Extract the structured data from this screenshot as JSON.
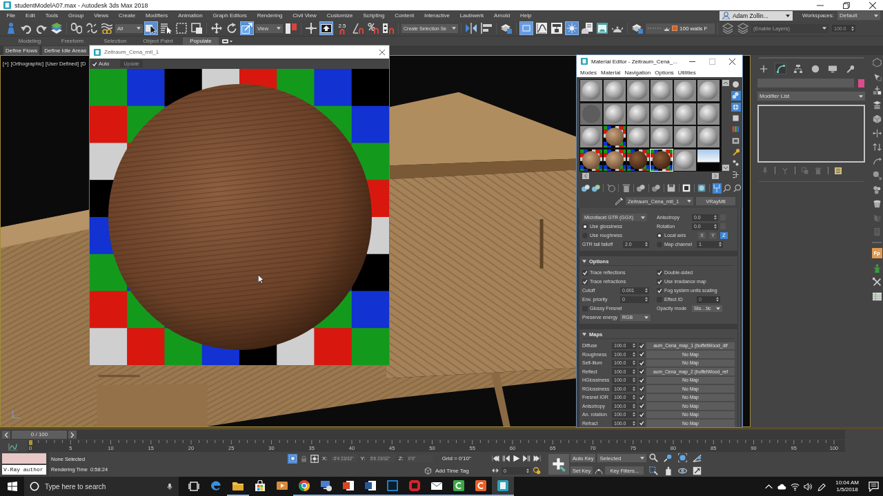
{
  "window": {
    "title": "studentModelA07.max - Autodesk 3ds Max 2018"
  },
  "menu": {
    "items": [
      "File",
      "Edit",
      "Tools",
      "Group",
      "Views",
      "Create",
      "Modifiers",
      "Animation",
      "Graph Editors",
      "Rendering",
      "Civil View",
      "Customize",
      "Scripting",
      "Content",
      "Interactive",
      "Laubwerk",
      "Arnold",
      "Help"
    ],
    "user": "Adam Zollin...",
    "workspaces_label": "Workspaces:",
    "workspace": "Default"
  },
  "main_toolbar": [
    {
      "kind": "button",
      "selected": false
    },
    {
      "kind": "button",
      "selected": false
    },
    {
      "kind": "button",
      "selected": false
    },
    {
      "kind": "button",
      "selected": false
    },
    {
      "kind": "separator"
    },
    {
      "kind": "button",
      "selected": false
    },
    {
      "kind": "button",
      "selected": false
    },
    {
      "kind": "button",
      "selected": false
    },
    {
      "kind": "dropdown",
      "value": "All",
      "disabled": false
    },
    {
      "kind": "button",
      "selected": true
    },
    {
      "kind": "button",
      "selected": false
    },
    {
      "kind": "button",
      "selected": false
    },
    {
      "kind": "button",
      "selected": false
    },
    {
      "kind": "separator"
    },
    {
      "kind": "button",
      "selected": false
    },
    {
      "kind": "button",
      "selected": false
    },
    {
      "kind": "button",
      "selected": true
    },
    {
      "kind": "dropdown",
      "value": "View",
      "disabled": false
    },
    {
      "kind": "button",
      "selected": false
    },
    {
      "kind": "separator"
    },
    {
      "kind": "button",
      "selected": false
    },
    {
      "kind": "button",
      "selected": true
    },
    {
      "kind": "snap",
      "label": "2.5",
      "selected": false
    },
    {
      "kind": "button",
      "selected": false
    },
    {
      "kind": "button",
      "selected": false
    },
    {
      "kind": "button",
      "selected": false
    },
    {
      "kind": "separator"
    },
    {
      "kind": "dropdown",
      "value": "Create Selection Se",
      "disabled": false
    },
    {
      "kind": "separator"
    },
    {
      "kind": "button",
      "selected": false
    },
    {
      "kind": "button",
      "selected": false
    },
    {
      "kind": "separator"
    },
    {
      "kind": "button",
      "selected": false
    },
    {
      "kind": "separator"
    },
    {
      "kind": "button",
      "selected": true
    },
    {
      "kind": "button",
      "selected": false
    },
    {
      "kind": "button",
      "selected": false
    },
    {
      "kind": "button",
      "selected": true
    },
    {
      "kind": "button",
      "selected": false
    },
    {
      "kind": "button",
      "selected": false
    },
    {
      "kind": "button",
      "selected": false
    },
    {
      "kind": "separator"
    },
    {
      "kind": "button",
      "selected": false
    },
    {
      "kind": "layer",
      "value": "100 walls F"
    },
    {
      "kind": "separator"
    },
    {
      "kind": "button",
      "selected": false
    },
    {
      "kind": "button",
      "selected": false
    },
    {
      "kind": "dropdown",
      "value": "(Enable Layers)",
      "disabled": true
    },
    {
      "kind": "spinner",
      "value": "100.0",
      "disabled": true
    }
  ],
  "ribbon": {
    "tabs": [
      {
        "label": "Modeling",
        "selected": false
      },
      {
        "label": "Freeform",
        "selected": false
      },
      {
        "label": "Selection",
        "selected": false
      },
      {
        "label": "Object Paint",
        "selected": false
      },
      {
        "label": "Populate",
        "selected": true
      }
    ],
    "buttons": [
      "Define Flows",
      "Define Idle Areas"
    ]
  },
  "viewport": {
    "labels": [
      "[+]",
      "[Orthographic]",
      "[User Defined]",
      "[D"
    ]
  },
  "render_window": {
    "title": "Zeitraum_Cena_mtl_1",
    "auto": {
      "label": "Auto",
      "checked": true
    },
    "update": {
      "label": "Update",
      "disabled": true
    }
  },
  "material_editor": {
    "title": "Material Editor - Zeitraum_Cena_...",
    "menu": [
      "Modes",
      "Material",
      "Navigation",
      "Options",
      "Utilities"
    ],
    "slots": [
      {
        "kind": "gray",
        "selected": false
      },
      {
        "kind": "gray",
        "selected": false
      },
      {
        "kind": "gray",
        "selected": false
      },
      {
        "kind": "gray",
        "selected": false
      },
      {
        "kind": "gray",
        "selected": false
      },
      {
        "kind": "gray",
        "selected": false
      },
      {
        "kind": "flat",
        "selected": false
      },
      {
        "kind": "gray",
        "selected": false
      },
      {
        "kind": "gray",
        "selected": false
      },
      {
        "kind": "gray",
        "selected": false
      },
      {
        "kind": "gray",
        "selected": false
      },
      {
        "kind": "gray",
        "selected": false
      },
      {
        "kind": "gray",
        "selected": false
      },
      {
        "kind": "wood",
        "selected": false
      },
      {
        "kind": "gray",
        "selected": false
      },
      {
        "kind": "gray",
        "selected": false
      },
      {
        "kind": "gray",
        "selected": false
      },
      {
        "kind": "gray",
        "selected": false
      },
      {
        "kind": "wood",
        "selected": false
      },
      {
        "kind": "wood",
        "selected": false
      },
      {
        "kind": "dark-wood",
        "selected": false
      },
      {
        "kind": "dark-wood",
        "selected": true
      },
      {
        "kind": "gray",
        "selected": false
      },
      {
        "kind": "sky",
        "selected": false
      }
    ],
    "side_buttons": [
      {
        "selected": false
      },
      {
        "selected": true
      },
      {
        "selected": true
      },
      {
        "selected": false
      },
      {
        "selected": false
      },
      {
        "selected": false
      },
      {
        "selected": false
      },
      {
        "selected": false
      },
      {
        "selected": false
      }
    ],
    "toolbar": [
      {
        "selected": false
      },
      {
        "selected": false
      },
      {
        "selected": false
      },
      {
        "selected": false
      },
      {
        "selected": false
      },
      {
        "selected": false
      },
      {
        "selected": false
      },
      {
        "selected": false
      },
      {
        "selected": false
      },
      {
        "selected": true
      },
      {
        "selected": false
      },
      {
        "selected": false
      }
    ],
    "material_name": "Zeitraum_Cena_mtl_1",
    "material_type": "VRayMtl",
    "brdf": {
      "model": "Microfacet GTR (GGX)",
      "modes": [
        {
          "label": "Use glossiness",
          "selected": true
        },
        {
          "label": "Use roughness",
          "selected": false
        }
      ],
      "tail_falloff": {
        "label": "GTR tail falloff",
        "value": "2.0"
      },
      "anisotropy": {
        "label": "Anisotropy",
        "value": "0.0"
      },
      "rotation": {
        "label": "Rotation",
        "value": "0.0"
      },
      "axis_sources": [
        {
          "label": "Local axis",
          "selected": true
        },
        {
          "label": "Map channel",
          "selected": false,
          "value": "1"
        }
      ],
      "axes": [
        {
          "label": "X",
          "selected": false
        },
        {
          "label": "Y",
          "selected": false
        },
        {
          "label": "Z",
          "selected": true
        }
      ]
    },
    "options": {
      "title": "Options",
      "expanded": true,
      "left": [
        {
          "kind": "check",
          "label": "Trace reflections",
          "checked": true
        },
        {
          "kind": "check",
          "label": "Trace refractions",
          "checked": true
        },
        {
          "kind": "spinner",
          "label": "Cutoff",
          "value": "0.001"
        },
        {
          "kind": "spinner",
          "label": "Env. priority",
          "value": "0"
        },
        {
          "kind": "check",
          "label": "Glossy Fresnel",
          "checked": false
        },
        {
          "kind": "dropdown",
          "label": "Preserve energy",
          "value": "RGB"
        }
      ],
      "right": [
        {
          "kind": "check",
          "label": "Double-sided",
          "checked": true
        },
        {
          "kind": "check",
          "label": "Use irradiance map",
          "checked": true
        },
        {
          "kind": "check",
          "label": "Fog system units scaling",
          "checked": true
        },
        {
          "kind": "check-spinner",
          "label": "Effect ID",
          "checked": false,
          "value": "0"
        },
        {
          "kind": "dropdown",
          "label": "Opacity mode",
          "value": "Sto…tic"
        }
      ]
    },
    "maps": {
      "title": "Maps",
      "expanded": true,
      "rows": [
        {
          "name": "Diffuse",
          "amount": "100.0",
          "enabled": true,
          "map": "aum_Cena_map_1 (buffetWood_dif"
        },
        {
          "name": "Roughness",
          "amount": "100.0",
          "enabled": true,
          "map": "No Map"
        },
        {
          "name": "Self-illum",
          "amount": "100.0",
          "enabled": true,
          "map": "No Map"
        },
        {
          "name": "Reflect",
          "amount": "100.0",
          "enabled": true,
          "map": "aum_Cena_map_2 (buffetWood_ref"
        },
        {
          "name": "HGlossiness",
          "amount": "100.0",
          "enabled": true,
          "map": "No Map"
        },
        {
          "name": "RGlossiness",
          "amount": "100.0",
          "enabled": true,
          "map": "No Map"
        },
        {
          "name": "Fresnel IOR",
          "amount": "100.0",
          "enabled": true,
          "map": "No Map"
        },
        {
          "name": "Anisotropy",
          "amount": "100.0",
          "enabled": true,
          "map": "No Map"
        },
        {
          "name": "An. rotation",
          "amount": "100.0",
          "enabled": true,
          "map": "No Map"
        },
        {
          "name": "Refract",
          "amount": "100.0",
          "enabled": true,
          "map": "No Map"
        }
      ]
    }
  },
  "command_panel": {
    "tabs": [
      {
        "selected": false
      },
      {
        "selected": true
      },
      {
        "selected": false
      },
      {
        "selected": false
      },
      {
        "selected": false
      },
      {
        "selected": false
      }
    ],
    "modifier_list": "Modifier List"
  },
  "side_toolbar": {
    "tile_label": "Fp"
  },
  "timeline": {
    "position": "0 / 100",
    "ticks": [
      "0",
      "5",
      "10",
      "15",
      "20",
      "25",
      "30",
      "35",
      "40",
      "45",
      "50",
      "55",
      "60",
      "65",
      "70",
      "75",
      "80",
      "85",
      "90",
      "95",
      "100"
    ]
  },
  "status": {
    "listener": "V-Ray author",
    "selection": "None Selected",
    "prompt": "Rendering Time  0:58:24",
    "isolate": {
      "selected": true
    },
    "coords": [
      {
        "label": "X:",
        "value": "-5'4 23/32\"",
        "disabled": true
      },
      {
        "label": "Y:",
        "value": "5'6 23/32\"",
        "disabled": true
      },
      {
        "label": "Z:",
        "value": "0'0\"",
        "disabled": true
      }
    ],
    "grid": "Grid = 0'10\"",
    "time_tag": "Add Time Tag",
    "frame": "0",
    "auto_key": "Auto Key",
    "key_mode": "Selected",
    "set_key": "Set Key",
    "key_filters": "Key Filters..."
  },
  "taskbar": {
    "search_placeholder": "Type here to search",
    "apps": [
      {
        "running": false,
        "active": false
      },
      {
        "running": true,
        "active": false
      },
      {
        "running": false,
        "active": false
      },
      {
        "running": false,
        "active": false
      },
      {
        "running": true,
        "active": false
      },
      {
        "running": true,
        "active": false
      },
      {
        "running": true,
        "active": false
      },
      {
        "running": true,
        "active": false
      },
      {
        "running": true,
        "active": false
      },
      {
        "running": true,
        "active": false
      },
      {
        "running": true,
        "active": false
      },
      {
        "running": true,
        "active": false
      },
      {
        "running": true,
        "active": false
      },
      {
        "running": true,
        "active": true
      }
    ],
    "time": "10:04 AM",
    "date": "1/5/2018"
  }
}
